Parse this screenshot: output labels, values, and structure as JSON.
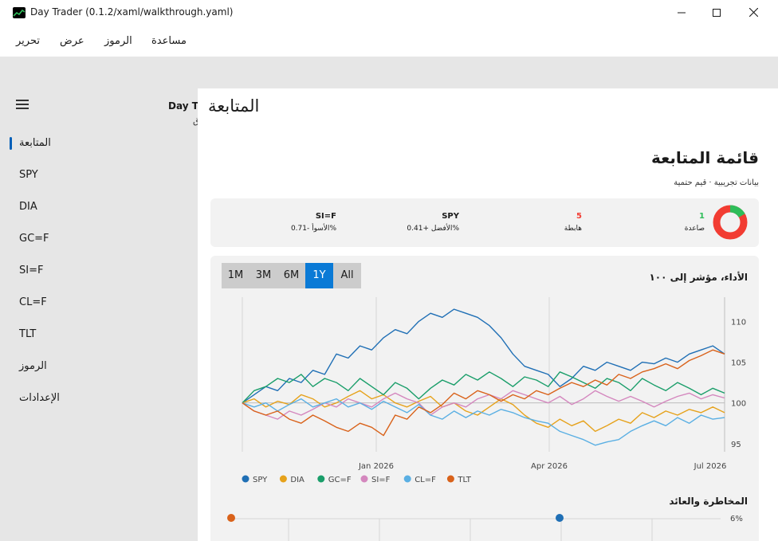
{
  "window": {
    "title": "Day Trader (0.1.2/xaml/walkthrough.yaml)"
  },
  "menu": {
    "items": [
      "تحرير",
      "عرض",
      "الرموز",
      "مساعدة"
    ]
  },
  "sidebar": {
    "app_title": "Day Tr",
    "app_sub": "ق",
    "items": [
      {
        "label": "المتابعة",
        "active": true
      },
      {
        "label": "SPY"
      },
      {
        "label": "DIA"
      },
      {
        "label": "GC=F"
      },
      {
        "label": "SI=F"
      },
      {
        "label": "CL=F"
      },
      {
        "label": "TLT"
      },
      {
        "label": "الرموز"
      },
      {
        "label": "الإعدادات"
      }
    ]
  },
  "main": {
    "page_title": "المتابعة",
    "section_title": "قائمة المتابعة",
    "section_sub": "بيانات تجريبية · قيم حتمية",
    "summary": {
      "up_count": "1",
      "up_label": "صاعدة",
      "down_count": "5",
      "down_label": "هابطة",
      "best_symbol": "SPY",
      "best_label": "الأفضل +0.41%",
      "worst_symbol": "SI=F",
      "worst_label": "الأسوأ -0.71%",
      "donut_up_fraction": 0.1667,
      "colors": {
        "up": "#2ebd59",
        "down": "#f23c32"
      }
    },
    "performance": {
      "title": "الأداء، مؤشر إلى ١٠٠",
      "ranges": [
        "1M",
        "3M",
        "6M",
        "1Y",
        "All"
      ],
      "active_range": "1Y"
    },
    "risk_title": "المخاطرة والعائد",
    "risk_axis_label": "6%"
  },
  "chart_data": {
    "type": "line",
    "x_ticks": [
      "Jan 2026",
      "Apr 2026",
      "Jul 2026"
    ],
    "y_ticks": [
      95,
      100,
      105,
      110
    ],
    "ylim": [
      94,
      112
    ],
    "series": [
      {
        "name": "SPY",
        "color": "#1f6fb5",
        "values": [
          100,
          101,
          102,
          101.5,
          103,
          102.5,
          104,
          103.5,
          106,
          105.5,
          107,
          106.5,
          108,
          109,
          108.5,
          110,
          111,
          110.5,
          111.5,
          111,
          110.5,
          109.5,
          108,
          106,
          104.5,
          104,
          103.5,
          102,
          103,
          104.5,
          104,
          105,
          104.5,
          104,
          105,
          104.8,
          105.5,
          105,
          106,
          106.5,
          107,
          106
        ]
      },
      {
        "name": "DIA",
        "color": "#e6a21b",
        "values": [
          100,
          100.5,
          99.5,
          100.2,
          99.8,
          101,
          100.5,
          99.5,
          100,
          100.8,
          101.5,
          100.5,
          101,
          100,
          99.5,
          100.2,
          100.8,
          99.5,
          100,
          99,
          98.5,
          99.5,
          100.5,
          99.8,
          98.5,
          97.5,
          97,
          98,
          97.2,
          97.8,
          96.5,
          97.2,
          98,
          97.5,
          98.8,
          98.2,
          99,
          98.5,
          99.2,
          98.8,
          99.5,
          98.8
        ]
      },
      {
        "name": "GC=F",
        "color": "#1a9e6a",
        "values": [
          100,
          101.5,
          102,
          103,
          102.5,
          103.5,
          102,
          103,
          102.5,
          101.5,
          103,
          102,
          101,
          102.5,
          101.8,
          100.5,
          101.8,
          102.8,
          102.2,
          103.5,
          102.8,
          103.8,
          103,
          102,
          103.2,
          102.8,
          102,
          103.8,
          103.2,
          102.5,
          101.8,
          103,
          102.5,
          101.5,
          103,
          102.2,
          101.5,
          102.5,
          101.8,
          101,
          101.8,
          101.2
        ]
      },
      {
        "name": "SI=F",
        "color": "#d487be",
        "values": [
          100,
          99,
          98.5,
          98,
          99,
          98.5,
          99.2,
          100,
          99.5,
          100.5,
          100,
          99.5,
          100.5,
          101.2,
          100.5,
          100,
          98.5,
          99.5,
          100,
          99.5,
          100.5,
          101,
          100.5,
          101.5,
          101,
          100.5,
          100,
          100.8,
          99.8,
          100.5,
          101.5,
          100.8,
          100.2,
          100.8,
          100.2,
          99.5,
          100.2,
          100.8,
          101.2,
          100.5,
          101,
          100.6
        ]
      },
      {
        "name": "CL=F",
        "color": "#5aafe3",
        "values": [
          100,
          99.5,
          100,
          99,
          99.8,
          100.5,
          99.5,
          100,
          100.5,
          99.5,
          100,
          99.2,
          100.2,
          99.5,
          98.8,
          99.8,
          98.5,
          98,
          99,
          98.2,
          99,
          98.5,
          99.2,
          98.8,
          98.2,
          97.8,
          97.5,
          96.5,
          96,
          95.5,
          94.8,
          95.2,
          95.5,
          96.5,
          97.2,
          97.8,
          97.2,
          98.2,
          97.5,
          98.5,
          98,
          98.2
        ]
      },
      {
        "name": "TLT",
        "color": "#d9621a",
        "values": [
          100,
          99,
          98.5,
          99,
          98,
          97.5,
          98.5,
          97.8,
          97,
          96.5,
          97.5,
          97,
          96,
          98.5,
          98,
          99.5,
          98.8,
          99.8,
          101.2,
          100.5,
          101.5,
          101,
          100.2,
          101,
          100.5,
          101.5,
          101,
          101.8,
          102.5,
          102,
          102.8,
          102.2,
          103.5,
          103,
          103.8,
          104.2,
          104.8,
          104.2,
          105.2,
          105.8,
          106.5,
          106
        ]
      }
    ]
  }
}
